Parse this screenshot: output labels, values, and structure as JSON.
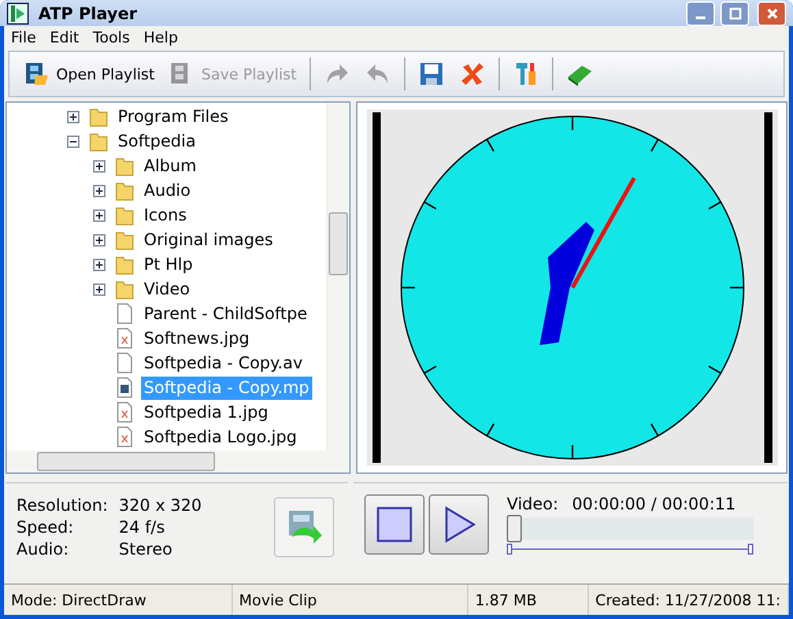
{
  "window": {
    "title": "ATP Player"
  },
  "menu": [
    "File",
    "Edit",
    "Tools",
    "Help"
  ],
  "toolbar": [
    {
      "kind": "text",
      "label": "Open Playlist",
      "disabled": false
    },
    {
      "kind": "text",
      "label": "Save Playlist",
      "disabled": true
    },
    {
      "kind": "sep"
    },
    {
      "kind": "icon",
      "disabled": true
    },
    {
      "kind": "icon",
      "disabled": true
    },
    {
      "kind": "sep"
    },
    {
      "kind": "icon",
      "disabled": false
    },
    {
      "kind": "icon",
      "disabled": false
    },
    {
      "kind": "sep"
    },
    {
      "kind": "icon",
      "disabled": false
    },
    {
      "kind": "sep"
    },
    {
      "kind": "icon",
      "disabled": false
    }
  ],
  "tree": [
    {
      "label": "Program Files",
      "kind": "folder",
      "expanded": false,
      "selected": false
    },
    {
      "label": "Softpedia",
      "kind": "folder",
      "expanded": true,
      "selected": false,
      "children": [
        {
          "label": "Album",
          "kind": "folder",
          "expanded": false,
          "selected": false
        },
        {
          "label": "Audio",
          "kind": "folder",
          "expanded": false,
          "selected": false
        },
        {
          "label": "Icons",
          "kind": "folder",
          "expanded": false,
          "selected": false
        },
        {
          "label": "Original images",
          "kind": "folder",
          "expanded": false,
          "selected": false
        },
        {
          "label": "Pt Hlp",
          "kind": "folder",
          "expanded": false,
          "selected": false
        },
        {
          "label": "Video",
          "kind": "folder",
          "expanded": false,
          "selected": false
        },
        {
          "label": "Parent - ChildSoftpe",
          "kind": "file",
          "selected": false
        },
        {
          "label": "Softnews.jpg",
          "kind": "image",
          "selected": false
        },
        {
          "label": "Softpedia - Copy.av",
          "kind": "file",
          "selected": false
        },
        {
          "label": "Softpedia - Copy.mp",
          "kind": "video",
          "selected": true
        },
        {
          "label": "Softpedia 1.jpg",
          "kind": "image",
          "selected": false
        },
        {
          "label": "Softpedia Logo.jpg",
          "kind": "image",
          "selected": false
        }
      ]
    }
  ],
  "info": [
    {
      "label": "Resolution:",
      "value": "320 x 320"
    },
    {
      "label": "Speed:",
      "value": "24 f/s"
    },
    {
      "label": "Audio:",
      "value": "Stereo"
    }
  ],
  "player": {
    "video_label": "Video:",
    "time": "00:00:00 / 00:00:11",
    "level": 0
  },
  "status_bar": [
    "Mode: DirectDraw",
    "Movie Clip",
    "1.87 MB",
    "Created: 11/27/2008 11:"
  ]
}
